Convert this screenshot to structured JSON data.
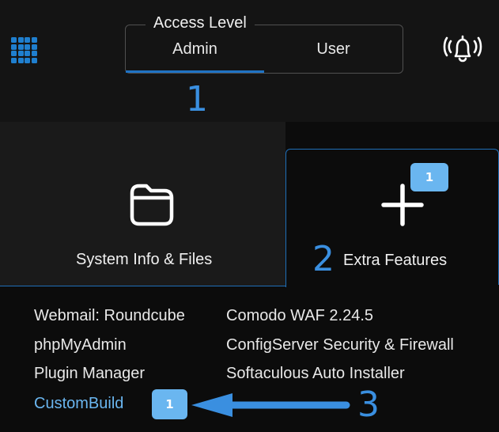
{
  "header": {
    "access_level": {
      "legend": "Access Level",
      "tabs": [
        {
          "label": "Admin",
          "active": true
        },
        {
          "label": "User",
          "active": false
        }
      ],
      "step_number": "1"
    },
    "icons": {
      "apps": "grid-apps-icon",
      "notifications": "bell-ringing-icon"
    }
  },
  "tabs": [
    {
      "label": "System Info & Files",
      "icon": "folder-icon",
      "active": false
    },
    {
      "label": "Extra Features",
      "icon": "plus-icon",
      "active": true,
      "badge": "1",
      "step_number": "2"
    }
  ],
  "features": {
    "left": [
      {
        "label": "Webmail: Roundcube"
      },
      {
        "label": "phpMyAdmin"
      },
      {
        "label": "Plugin Manager"
      },
      {
        "label": "CustomBuild",
        "badge": "1",
        "highlighted": true
      }
    ],
    "right": [
      {
        "label": "Comodo WAF 2.24.5"
      },
      {
        "label": "ConfigServer Security & Firewall"
      },
      {
        "label": "Softaculous Auto Installer"
      }
    ]
  },
  "annotation": {
    "step_number": "3",
    "arrow_color": "#3a8fe0"
  },
  "colors": {
    "accent": "#1f73c4",
    "badge": "#6ab6f0",
    "link": "#6ab6f0",
    "background": "#141414",
    "panel": "#0c0c0c"
  }
}
